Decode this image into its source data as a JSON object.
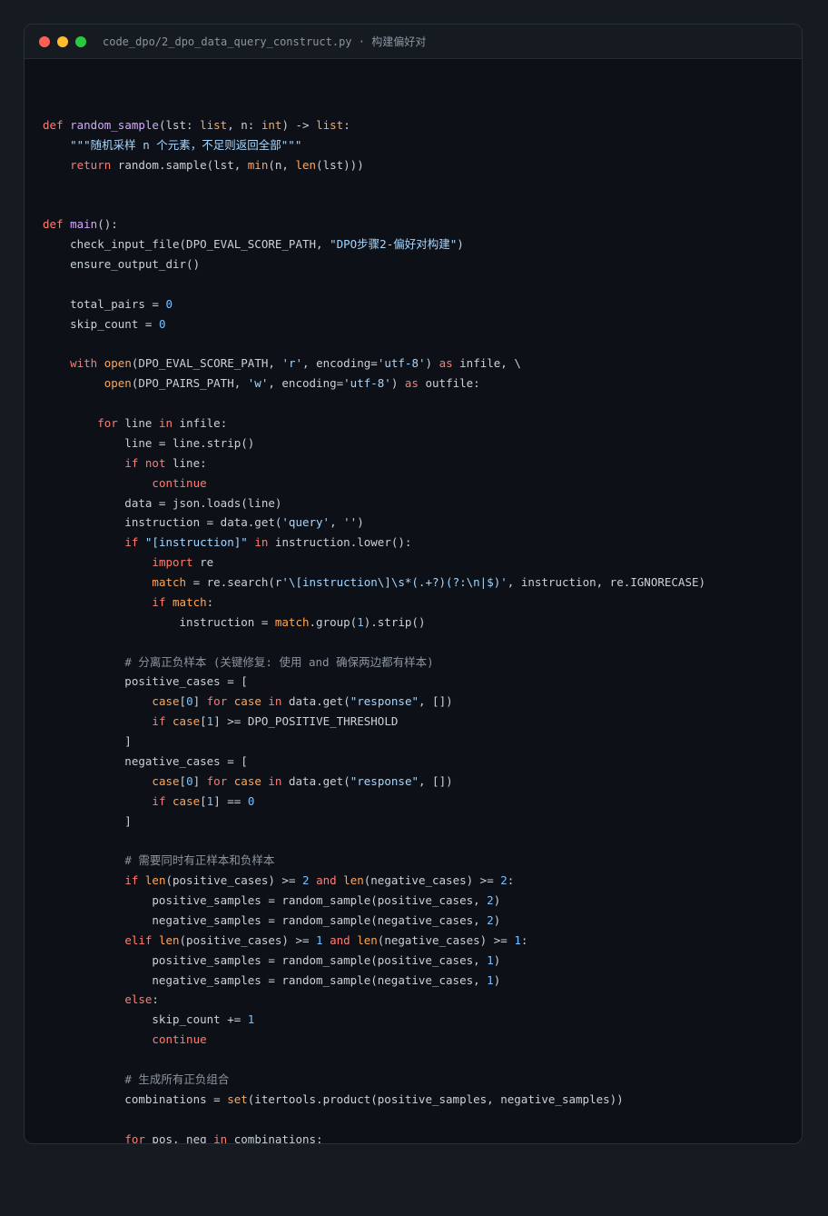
{
  "window": {
    "title": "code_dpo/2_dpo_data_query_construct.py · 构建偏好对",
    "dots": {
      "close": "#ff5f56",
      "minimize": "#ffbd2e",
      "maximize": "#27c93f"
    }
  },
  "colors": {
    "background": "#0d1117",
    "keyword": "#ff7b72",
    "function": "#d2a8ff",
    "builtin": "#ffa657",
    "string": "#a5d6ff",
    "number": "#79c0ff",
    "comment": "#8b949e",
    "text": "#c9d1d9"
  },
  "code": {
    "lines": [
      [],
      [
        [
          "kw",
          "def"
        ],
        [
          "t",
          " "
        ],
        [
          "fn",
          "random_sample"
        ],
        [
          "t",
          "(lst: "
        ],
        [
          "bi",
          "list"
        ],
        [
          "t",
          ", n: "
        ],
        [
          "bi",
          "int"
        ],
        [
          "t",
          ") -> "
        ],
        [
          "bi",
          "list"
        ],
        [
          "t",
          ":"
        ]
      ],
      [
        [
          "t",
          "    "
        ],
        [
          "str",
          "\"\"\"随机采样 n 个元素，不足则返回全部\"\"\""
        ]
      ],
      [
        [
          "t",
          "    "
        ],
        [
          "kw",
          "return"
        ],
        [
          "t",
          " random.sample(lst, "
        ],
        [
          "bi",
          "min"
        ],
        [
          "t",
          "(n, "
        ],
        [
          "bi",
          "len"
        ],
        [
          "t",
          "(lst)))"
        ]
      ],
      [],
      [],
      [
        [
          "kw",
          "def"
        ],
        [
          "t",
          " "
        ],
        [
          "fn",
          "main"
        ],
        [
          "t",
          "():"
        ]
      ],
      [
        [
          "t",
          "    check_input_file(DPO_EVAL_SCORE_PATH, "
        ],
        [
          "str",
          "\"DPO步骤2-偏好对构建\""
        ],
        [
          "t",
          ")"
        ]
      ],
      [
        [
          "t",
          "    ensure_output_dir()"
        ]
      ],
      [],
      [
        [
          "t",
          "    total_pairs = "
        ],
        [
          "num",
          "0"
        ]
      ],
      [
        [
          "t",
          "    skip_count = "
        ],
        [
          "num",
          "0"
        ]
      ],
      [],
      [
        [
          "t",
          "    "
        ],
        [
          "kw",
          "with"
        ],
        [
          "t",
          " "
        ],
        [
          "bi",
          "open"
        ],
        [
          "t",
          "(DPO_EVAL_SCORE_PATH, "
        ],
        [
          "str",
          "'r'"
        ],
        [
          "t",
          ", encoding="
        ],
        [
          "str",
          "'utf-8'"
        ],
        [
          "t",
          ") "
        ],
        [
          "kw",
          "as"
        ],
        [
          "t",
          " infile, \\"
        ]
      ],
      [
        [
          "t",
          "         "
        ],
        [
          "bi",
          "open"
        ],
        [
          "t",
          "(DPO_PAIRS_PATH, "
        ],
        [
          "str",
          "'w'"
        ],
        [
          "t",
          ", encoding="
        ],
        [
          "str",
          "'utf-8'"
        ],
        [
          "t",
          ") "
        ],
        [
          "kw",
          "as"
        ],
        [
          "t",
          " outfile:"
        ]
      ],
      [],
      [
        [
          "t",
          "        "
        ],
        [
          "kw",
          "for"
        ],
        [
          "t",
          " line "
        ],
        [
          "kw",
          "in"
        ],
        [
          "t",
          " infile:"
        ]
      ],
      [
        [
          "t",
          "            line = line.strip()"
        ]
      ],
      [
        [
          "t",
          "            "
        ],
        [
          "kw",
          "if not"
        ],
        [
          "t",
          " line:"
        ]
      ],
      [
        [
          "t",
          "                "
        ],
        [
          "kw",
          "continue"
        ]
      ],
      [
        [
          "t",
          "            data = json.loads(line)"
        ]
      ],
      [
        [
          "t",
          "            instruction = data.get("
        ],
        [
          "str",
          "'query'"
        ],
        [
          "t",
          ", "
        ],
        [
          "str",
          "''"
        ],
        [
          "t",
          ")"
        ]
      ],
      [
        [
          "t",
          "            "
        ],
        [
          "kw",
          "if"
        ],
        [
          "t",
          " "
        ],
        [
          "str",
          "\"[instruction]\""
        ],
        [
          "t",
          " "
        ],
        [
          "kw",
          "in"
        ],
        [
          "t",
          " instruction.lower():"
        ]
      ],
      [
        [
          "t",
          "                "
        ],
        [
          "kw",
          "import"
        ],
        [
          "t",
          " re"
        ]
      ],
      [
        [
          "t",
          "                "
        ],
        [
          "bi",
          "match"
        ],
        [
          "t",
          " = re.search(r"
        ],
        [
          "str",
          "'\\[instruction\\]\\s*(.+?)(?:\\n|$)'"
        ],
        [
          "t",
          ", instruction, re.IGNORECASE)"
        ]
      ],
      [
        [
          "t",
          "                "
        ],
        [
          "kw",
          "if"
        ],
        [
          "t",
          " "
        ],
        [
          "bi",
          "match"
        ],
        [
          "t",
          ":"
        ]
      ],
      [
        [
          "t",
          "                    instruction = "
        ],
        [
          "bi",
          "match"
        ],
        [
          "t",
          ".group("
        ],
        [
          "num",
          "1"
        ],
        [
          "t",
          ").strip()"
        ]
      ],
      [],
      [
        [
          "t",
          "            "
        ],
        [
          "cm",
          "# 分离正负样本 (关键修复: 使用 and 确保两边都有样本)"
        ]
      ],
      [
        [
          "t",
          "            positive_cases = ["
        ]
      ],
      [
        [
          "t",
          "                "
        ],
        [
          "bi",
          "case"
        ],
        [
          "t",
          "["
        ],
        [
          "num",
          "0"
        ],
        [
          "t",
          "] "
        ],
        [
          "kw",
          "for"
        ],
        [
          "t",
          " "
        ],
        [
          "bi",
          "case"
        ],
        [
          "t",
          " "
        ],
        [
          "kw",
          "in"
        ],
        [
          "t",
          " data.get("
        ],
        [
          "str",
          "\"response\""
        ],
        [
          "t",
          ", [])"
        ]
      ],
      [
        [
          "t",
          "                "
        ],
        [
          "kw",
          "if"
        ],
        [
          "t",
          " "
        ],
        [
          "bi",
          "case"
        ],
        [
          "t",
          "["
        ],
        [
          "num",
          "1"
        ],
        [
          "t",
          "] >= DPO_POSITIVE_THRESHOLD"
        ]
      ],
      [
        [
          "t",
          "            ]"
        ]
      ],
      [
        [
          "t",
          "            negative_cases = ["
        ]
      ],
      [
        [
          "t",
          "                "
        ],
        [
          "bi",
          "case"
        ],
        [
          "t",
          "["
        ],
        [
          "num",
          "0"
        ],
        [
          "t",
          "] "
        ],
        [
          "kw",
          "for"
        ],
        [
          "t",
          " "
        ],
        [
          "bi",
          "case"
        ],
        [
          "t",
          " "
        ],
        [
          "kw",
          "in"
        ],
        [
          "t",
          " data.get("
        ],
        [
          "str",
          "\"response\""
        ],
        [
          "t",
          ", [])"
        ]
      ],
      [
        [
          "t",
          "                "
        ],
        [
          "kw",
          "if"
        ],
        [
          "t",
          " "
        ],
        [
          "bi",
          "case"
        ],
        [
          "t",
          "["
        ],
        [
          "num",
          "1"
        ],
        [
          "t",
          "] == "
        ],
        [
          "num",
          "0"
        ]
      ],
      [
        [
          "t",
          "            ]"
        ]
      ],
      [],
      [
        [
          "t",
          "            "
        ],
        [
          "cm",
          "# 需要同时有正样本和负样本"
        ]
      ],
      [
        [
          "t",
          "            "
        ],
        [
          "kw",
          "if"
        ],
        [
          "t",
          " "
        ],
        [
          "bi",
          "len"
        ],
        [
          "t",
          "(positive_cases) >= "
        ],
        [
          "num",
          "2"
        ],
        [
          "t",
          " "
        ],
        [
          "kw",
          "and"
        ],
        [
          "t",
          " "
        ],
        [
          "bi",
          "len"
        ],
        [
          "t",
          "(negative_cases) >= "
        ],
        [
          "num",
          "2"
        ],
        [
          "t",
          ":"
        ]
      ],
      [
        [
          "t",
          "                positive_samples = random_sample(positive_cases, "
        ],
        [
          "num",
          "2"
        ],
        [
          "t",
          ")"
        ]
      ],
      [
        [
          "t",
          "                negative_samples = random_sample(negative_cases, "
        ],
        [
          "num",
          "2"
        ],
        [
          "t",
          ")"
        ]
      ],
      [
        [
          "t",
          "            "
        ],
        [
          "kw",
          "elif"
        ],
        [
          "t",
          " "
        ],
        [
          "bi",
          "len"
        ],
        [
          "t",
          "(positive_cases) >= "
        ],
        [
          "num",
          "1"
        ],
        [
          "t",
          " "
        ],
        [
          "kw",
          "and"
        ],
        [
          "t",
          " "
        ],
        [
          "bi",
          "len"
        ],
        [
          "t",
          "(negative_cases) >= "
        ],
        [
          "num",
          "1"
        ],
        [
          "t",
          ":"
        ]
      ],
      [
        [
          "t",
          "                positive_samples = random_sample(positive_cases, "
        ],
        [
          "num",
          "1"
        ],
        [
          "t",
          ")"
        ]
      ],
      [
        [
          "t",
          "                negative_samples = random_sample(negative_cases, "
        ],
        [
          "num",
          "1"
        ],
        [
          "t",
          ")"
        ]
      ],
      [
        [
          "t",
          "            "
        ],
        [
          "kw",
          "else"
        ],
        [
          "t",
          ":"
        ]
      ],
      [
        [
          "t",
          "                skip_count += "
        ],
        [
          "num",
          "1"
        ]
      ],
      [
        [
          "t",
          "                "
        ],
        [
          "kw",
          "continue"
        ]
      ],
      [],
      [
        [
          "t",
          "            "
        ],
        [
          "cm",
          "# 生成所有正负组合"
        ]
      ],
      [
        [
          "t",
          "            combinations = "
        ],
        [
          "bi",
          "set"
        ],
        [
          "t",
          "(itertools.product(positive_samples, negative_samples))"
        ]
      ],
      [],
      [
        [
          "t",
          "            "
        ],
        [
          "kw",
          "for"
        ],
        [
          "t",
          " pos, neg "
        ],
        [
          "kw",
          "in"
        ],
        [
          "t",
          " combinations:"
        ]
      ]
    ]
  }
}
